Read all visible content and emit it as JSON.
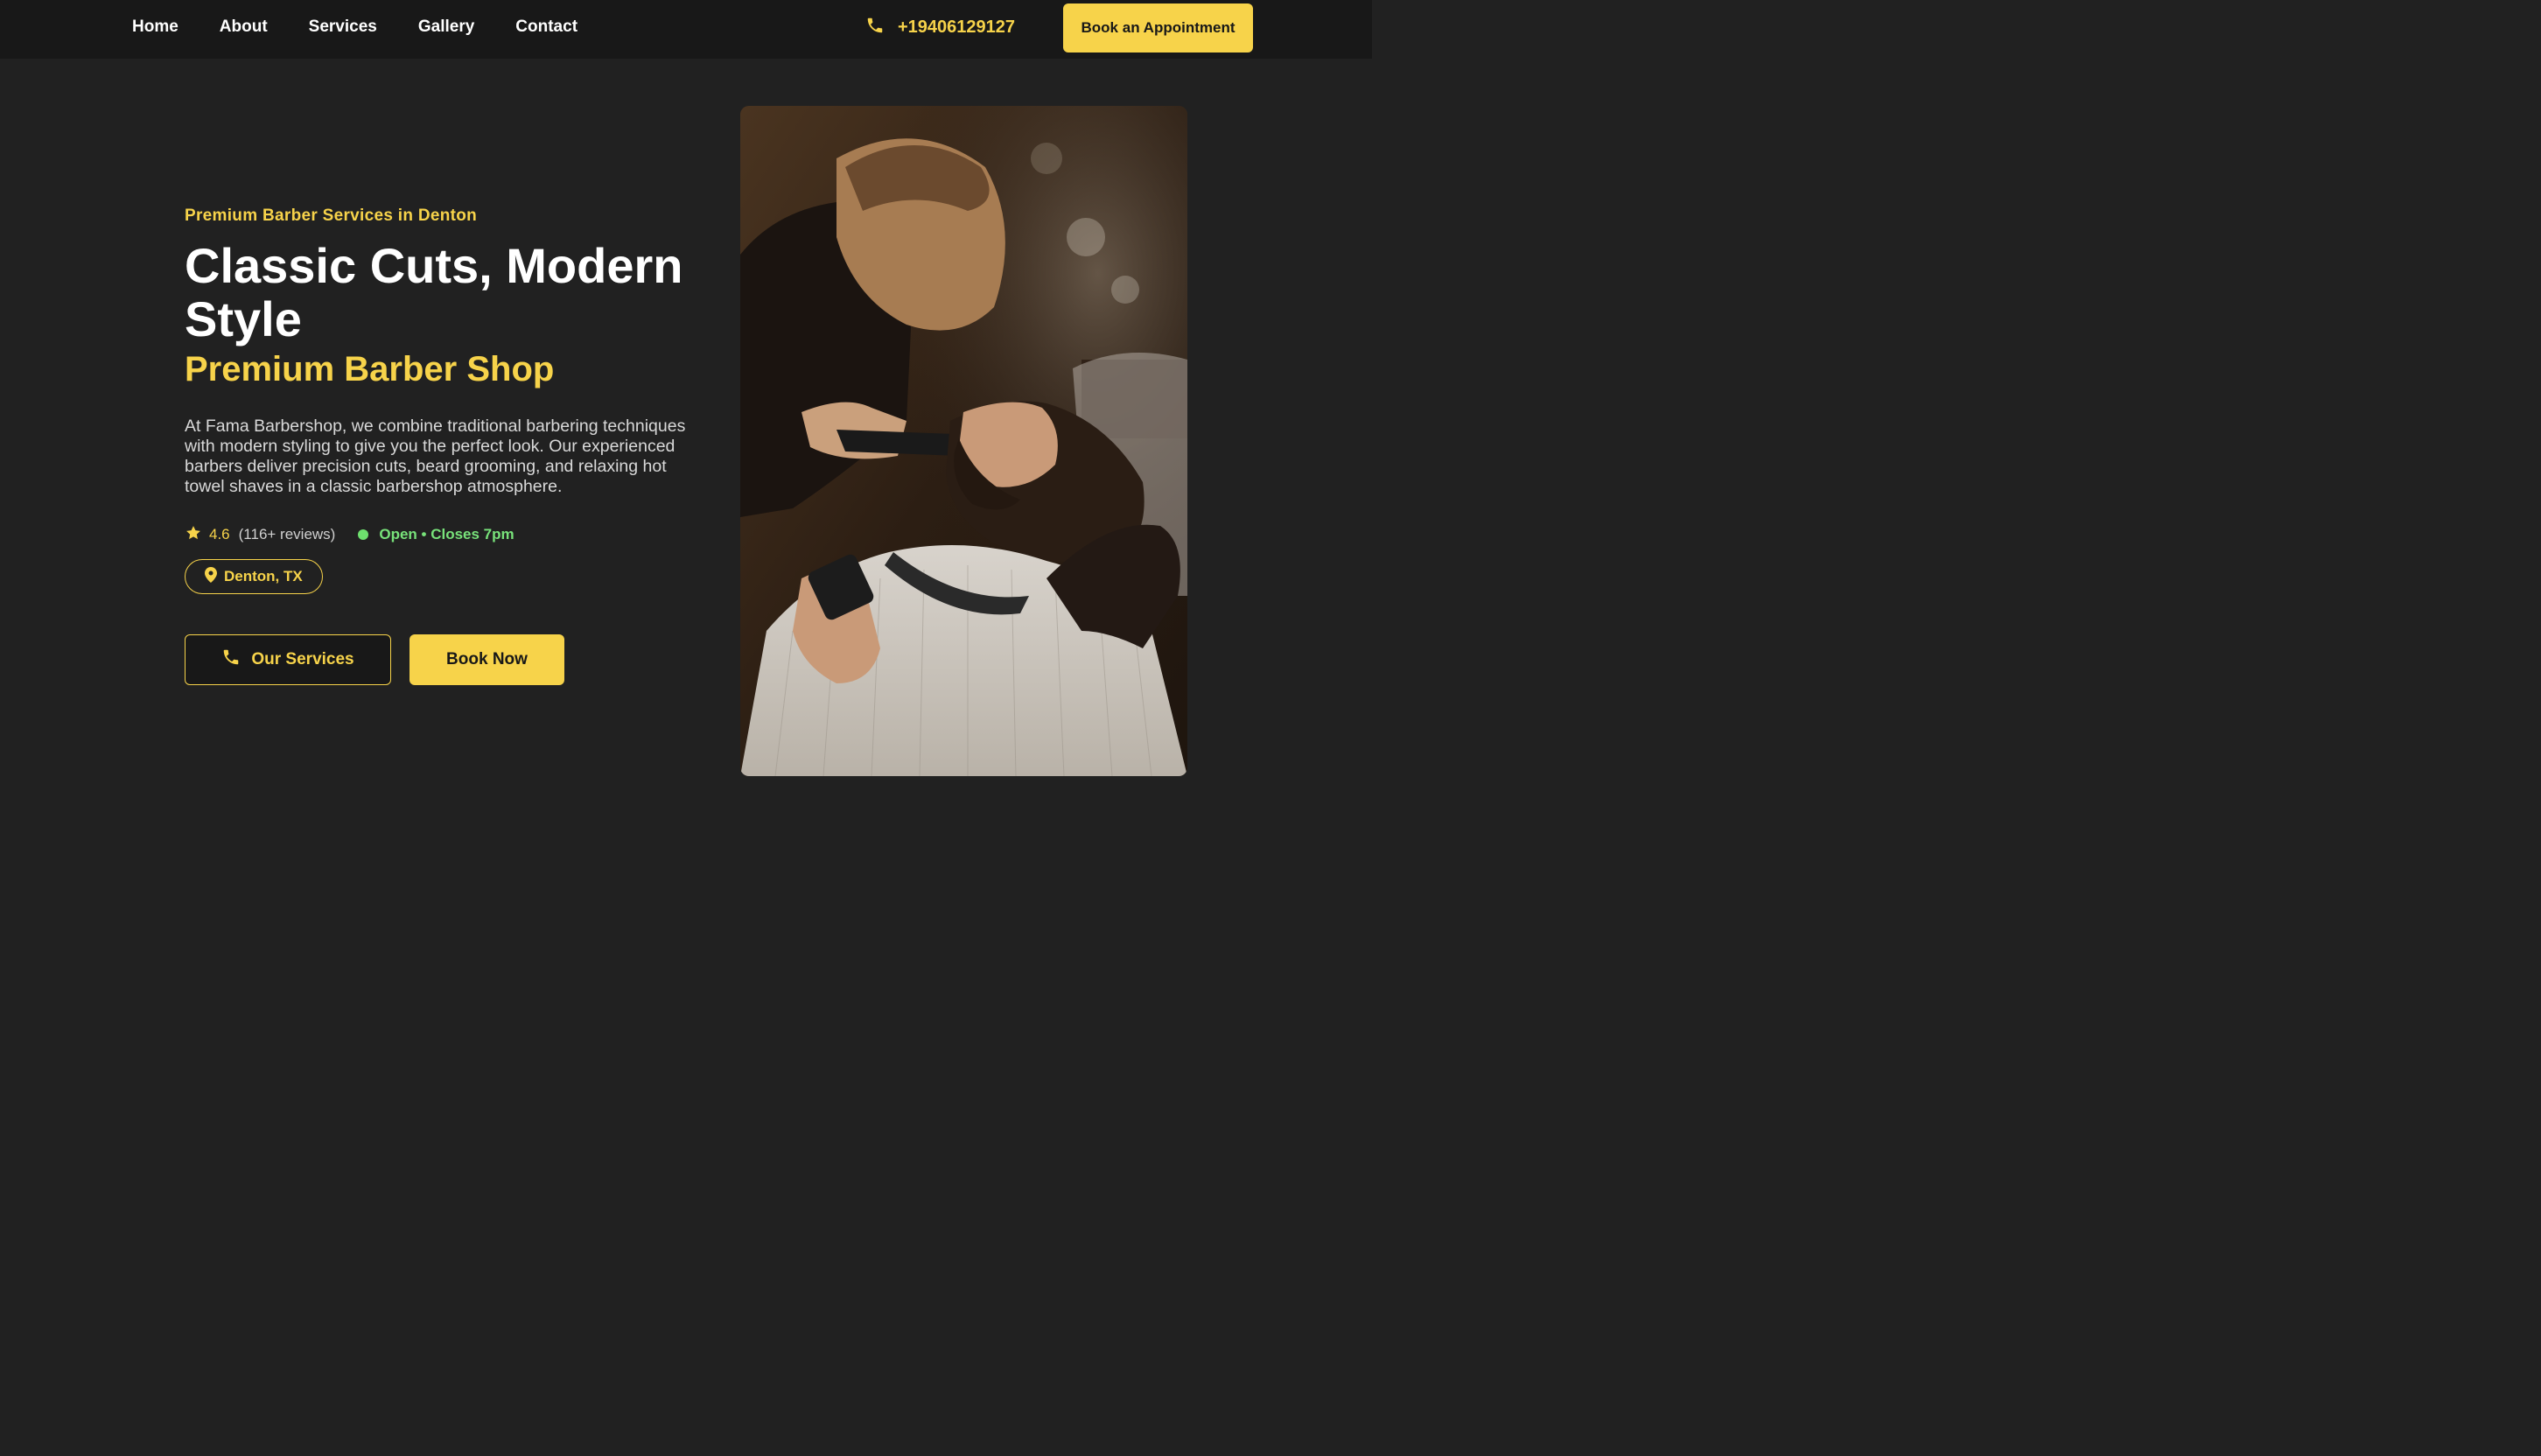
{
  "nav": {
    "links": [
      "Home",
      "About",
      "Services",
      "Gallery",
      "Contact"
    ],
    "phone": "+19406129127",
    "book_label": "Book an Appointment",
    "phone_icon": "phone-icon"
  },
  "hero": {
    "eyebrow": "Premium Barber Services in Denton",
    "headline": "Classic Cuts, Modern Style",
    "subheadline": "Premium Barber Shop",
    "description": "At Fama Barbershop, we combine traditional barbering techniques with modern styling to give you the perfect look. Our experienced barbers deliver precision cuts, beard grooming, and relaxing hot towel shaves in a classic barbershop atmosphere.",
    "rating": "4.6",
    "reviews": "(116+ reviews)",
    "status": "Open • Closes 7pm",
    "location": "Denton, TX",
    "cta_primary": "Our Services",
    "cta_secondary": "Book Now",
    "rating_icon": "star-icon",
    "location_icon": "map-pin-icon",
    "status_icon": "status-dot-icon"
  },
  "colors": {
    "accent": "#f7d34a",
    "background": "#212121",
    "navbar": "#181818",
    "open_status": "#78e27a"
  }
}
